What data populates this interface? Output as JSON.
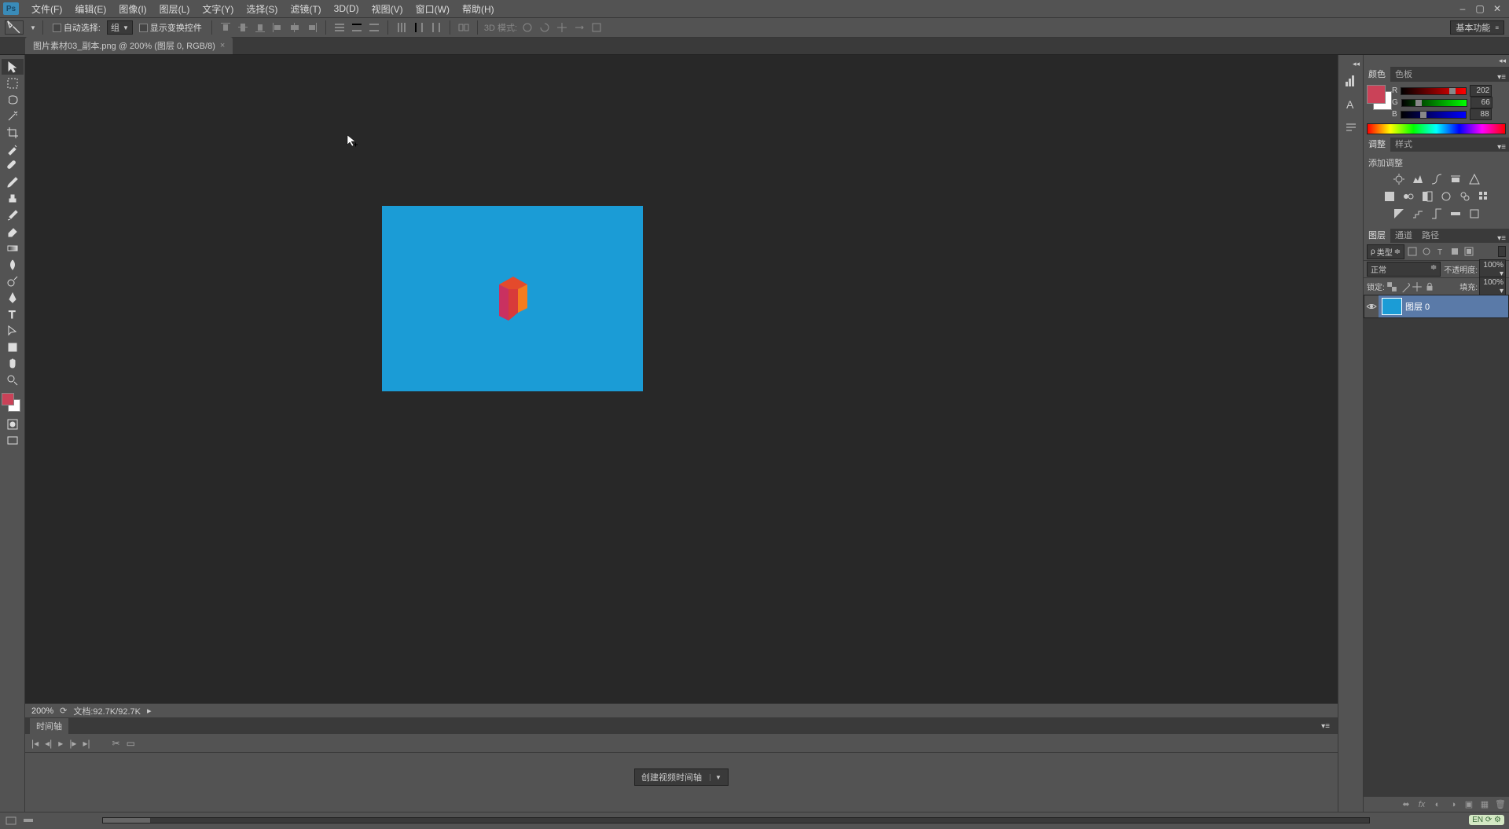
{
  "menubar": {
    "logo": "Ps",
    "items": [
      "文件(F)",
      "编辑(E)",
      "图像(I)",
      "图层(L)",
      "文字(Y)",
      "选择(S)",
      "滤镜(T)",
      "3D(D)",
      "视图(V)",
      "窗口(W)",
      "帮助(H)"
    ]
  },
  "options": {
    "auto_select_label": "自动选择:",
    "auto_select_value": "组",
    "show_transform_label": "显示变换控件",
    "mode_3d_label": "3D 模式:",
    "workspace": "基本功能"
  },
  "tab": {
    "filename": "图片素材03_副本.png @ 200% (图层 0, RGB/8)"
  },
  "status": {
    "zoom": "200%",
    "doc_info": "文档:92.7K/92.7K"
  },
  "timeline": {
    "title": "时间轴",
    "create_btn": "创建视频时间轴"
  },
  "panels": {
    "color": {
      "tab1": "颜色",
      "tab2": "色板",
      "r_label": "R",
      "r_value": "202",
      "g_label": "G",
      "g_value": "66",
      "b_label": "B",
      "b_value": "88",
      "fg_color": "#ca4258"
    },
    "adjust": {
      "tab1": "调整",
      "tab2": "样式",
      "header": "添加调整"
    },
    "layers": {
      "tab1": "图层",
      "tab2": "通道",
      "tab3": "路径",
      "filter_kind": "类型",
      "blend_mode": "正常",
      "opacity_label": "不透明度:",
      "opacity_value": "100%",
      "lock_label": "锁定:",
      "fill_label": "填充:",
      "fill_value": "100%",
      "layer0_name": "图层 0"
    }
  },
  "lang": "EN"
}
